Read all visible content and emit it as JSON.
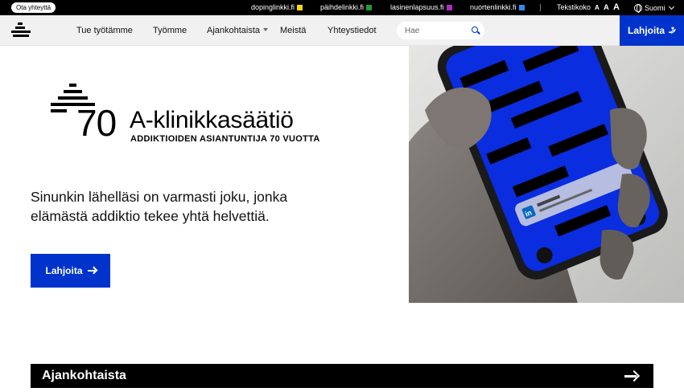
{
  "topbar": {
    "contact_label": "Ota yhteyttä",
    "sites": [
      {
        "label": "dopinglinkki.fi",
        "color": "#f5d90a"
      },
      {
        "label": "päihdelinkki.fi",
        "color": "#1f9d2a"
      },
      {
        "label": "lasinenlapsuus.fi",
        "color": "#b02ac4"
      },
      {
        "label": "nuortenlinkki.fi",
        "color": "#2d8cf0"
      }
    ],
    "text_size_label": "Tekstikoko",
    "font_sizes": [
      "A",
      "A",
      "A"
    ],
    "language": "Suomi"
  },
  "nav": {
    "items": [
      "Tue työtämme",
      "Työmme",
      "Ajankohtaista",
      "Meistä",
      "Yhteystiedot"
    ],
    "search_placeholder": "Hae",
    "donate_label": "Lahjoita"
  },
  "hero": {
    "logo_number": "70",
    "logo_name": "A-klinikkasäätiö",
    "logo_tagline": "ADDIKTIOIDEN ASIANTUNTIJA 70 VUOTTA",
    "text": "Sinunkin lähelläsi on varmasti joku, jonka elämästä addiktio tekee yhtä helvettiä.",
    "button_label": "Lahjoita",
    "image_notification": {
      "app": "LinkedIn",
      "message": "Addiktio alkoi seurata sinua"
    }
  },
  "news": {
    "title": "Ajankohtaista"
  },
  "colors": {
    "brand_blue": "#0033cc",
    "topbar_bg": "#000000",
    "nav_bg": "#f1f1f1"
  }
}
